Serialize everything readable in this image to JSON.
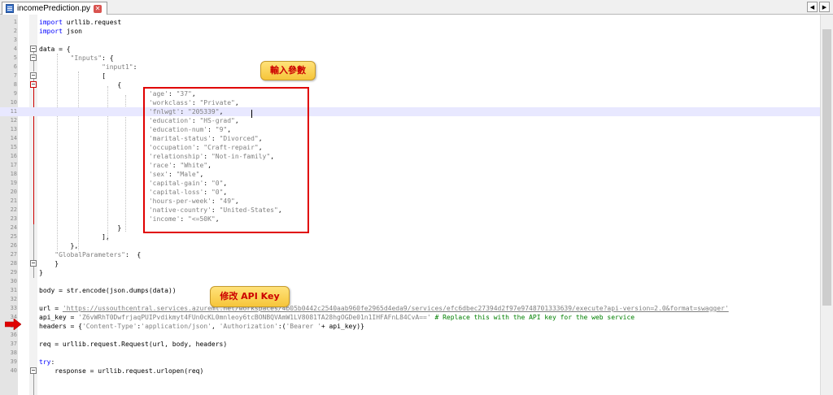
{
  "tab": {
    "filename": "incomePrediction.py",
    "close_glyph": "✕"
  },
  "nav": {
    "prev_glyph": "◀",
    "next_glyph": "▶"
  },
  "callouts": {
    "input_params": "輸入參數",
    "modify_api_key": "修改 API Key"
  },
  "colors": {
    "keyword": "#0000ff",
    "string": "#808080",
    "comment": "#008000",
    "highlight": "#e8e8ff",
    "annotation_box": "#e00000",
    "callout_bg": "#f6c53a",
    "callout_text": "#cc0000",
    "arrow": "#e00000"
  },
  "lines": [
    {
      "n": "1",
      "segs": [
        {
          "t": "import",
          "c": "kw"
        },
        {
          "t": " urllib.request"
        }
      ]
    },
    {
      "n": "2",
      "segs": [
        {
          "t": "import",
          "c": "kw"
        },
        {
          "t": " json"
        }
      ]
    },
    {
      "n": "3",
      "segs": []
    },
    {
      "n": "4",
      "segs": [
        {
          "t": "data = {"
        }
      ]
    },
    {
      "n": "5",
      "segs": [
        {
          "t": "        "
        },
        {
          "t": "\"Inputs\"",
          "c": "str"
        },
        {
          "t": ": {"
        }
      ]
    },
    {
      "n": "6",
      "segs": [
        {
          "t": "                "
        },
        {
          "t": "\"input1\"",
          "c": "str"
        },
        {
          "t": ":"
        }
      ]
    },
    {
      "n": "7",
      "segs": [
        {
          "t": "                ["
        }
      ]
    },
    {
      "n": "8",
      "segs": [
        {
          "t": "                    {"
        }
      ]
    },
    {
      "n": "9",
      "segs": [
        {
          "t": "                            "
        },
        {
          "t": "'age'",
          "c": "str"
        },
        {
          "t": ": "
        },
        {
          "t": "\"37\"",
          "c": "str"
        },
        {
          "t": ","
        }
      ]
    },
    {
      "n": "10",
      "segs": [
        {
          "t": "                            "
        },
        {
          "t": "'workclass'",
          "c": "str"
        },
        {
          "t": ": "
        },
        {
          "t": "\"Private\"",
          "c": "str"
        },
        {
          "t": ","
        }
      ]
    },
    {
      "n": "11",
      "segs": [
        {
          "t": "                            "
        },
        {
          "t": "'fnlwgt'",
          "c": "str"
        },
        {
          "t": ": "
        },
        {
          "t": "\"205339\"",
          "c": "str"
        },
        {
          "t": ","
        }
      ]
    },
    {
      "n": "12",
      "segs": [
        {
          "t": "                            "
        },
        {
          "t": "'education'",
          "c": "str"
        },
        {
          "t": ": "
        },
        {
          "t": "\"HS-grad\"",
          "c": "str"
        },
        {
          "t": ","
        }
      ]
    },
    {
      "n": "13",
      "segs": [
        {
          "t": "                            "
        },
        {
          "t": "'education-num'",
          "c": "str"
        },
        {
          "t": ": "
        },
        {
          "t": "\"9\"",
          "c": "str"
        },
        {
          "t": ","
        }
      ]
    },
    {
      "n": "14",
      "segs": [
        {
          "t": "                            "
        },
        {
          "t": "'marital-status'",
          "c": "str"
        },
        {
          "t": ": "
        },
        {
          "t": "\"Divorced\"",
          "c": "str"
        },
        {
          "t": ","
        }
      ]
    },
    {
      "n": "15",
      "segs": [
        {
          "t": "                            "
        },
        {
          "t": "'occupation'",
          "c": "str"
        },
        {
          "t": ": "
        },
        {
          "t": "\"Craft-repair\"",
          "c": "str"
        },
        {
          "t": ","
        }
      ]
    },
    {
      "n": "16",
      "segs": [
        {
          "t": "                            "
        },
        {
          "t": "'relationship'",
          "c": "str"
        },
        {
          "t": ": "
        },
        {
          "t": "\"Not-in-family\"",
          "c": "str"
        },
        {
          "t": ","
        }
      ]
    },
    {
      "n": "17",
      "segs": [
        {
          "t": "                            "
        },
        {
          "t": "'race'",
          "c": "str"
        },
        {
          "t": ": "
        },
        {
          "t": "\"White\"",
          "c": "str"
        },
        {
          "t": ","
        }
      ]
    },
    {
      "n": "18",
      "segs": [
        {
          "t": "                            "
        },
        {
          "t": "'sex'",
          "c": "str"
        },
        {
          "t": ": "
        },
        {
          "t": "\"Male\"",
          "c": "str"
        },
        {
          "t": ","
        }
      ]
    },
    {
      "n": "19",
      "segs": [
        {
          "t": "                            "
        },
        {
          "t": "'capital-gain'",
          "c": "str"
        },
        {
          "t": ": "
        },
        {
          "t": "\"0\"",
          "c": "str"
        },
        {
          "t": ","
        }
      ]
    },
    {
      "n": "20",
      "segs": [
        {
          "t": "                            "
        },
        {
          "t": "'capital-loss'",
          "c": "str"
        },
        {
          "t": ": "
        },
        {
          "t": "\"0\"",
          "c": "str"
        },
        {
          "t": ","
        }
      ]
    },
    {
      "n": "21",
      "segs": [
        {
          "t": "                            "
        },
        {
          "t": "'hours-per-week'",
          "c": "str"
        },
        {
          "t": ": "
        },
        {
          "t": "\"49\"",
          "c": "str"
        },
        {
          "t": ","
        }
      ]
    },
    {
      "n": "22",
      "segs": [
        {
          "t": "                            "
        },
        {
          "t": "'native-country'",
          "c": "str"
        },
        {
          "t": ": "
        },
        {
          "t": "\"United-States\"",
          "c": "str"
        },
        {
          "t": ","
        }
      ]
    },
    {
      "n": "23",
      "segs": [
        {
          "t": "                            "
        },
        {
          "t": "'income'",
          "c": "str"
        },
        {
          "t": ": "
        },
        {
          "t": "\"<=50K\"",
          "c": "str"
        },
        {
          "t": ","
        }
      ]
    },
    {
      "n": "24",
      "segs": [
        {
          "t": "                    }"
        }
      ]
    },
    {
      "n": "25",
      "segs": [
        {
          "t": "                ],"
        }
      ]
    },
    {
      "n": "26",
      "segs": [
        {
          "t": "        },"
        }
      ]
    },
    {
      "n": "27",
      "segs": [
        {
          "t": "    "
        },
        {
          "t": "\"GlobalParameters\"",
          "c": "str"
        },
        {
          "t": ":  {"
        }
      ]
    },
    {
      "n": "28",
      "segs": [
        {
          "t": "    }"
        }
      ]
    },
    {
      "n": "29",
      "segs": [
        {
          "t": "}"
        }
      ]
    },
    {
      "n": "30",
      "segs": []
    },
    {
      "n": "31",
      "segs": [
        {
          "t": "body = str.encode(json.dumps(data))"
        }
      ]
    },
    {
      "n": "32",
      "segs": []
    },
    {
      "n": "33",
      "segs": [
        {
          "t": "url = "
        },
        {
          "t": "'https://ussouthcentral.services.azureml.net/workspaces/4b05b0442c2540aab960fe2965d4eda9/services/efc6dbec27394d2f97e9748701333639/execute?api-version=2.0&format=swagger'",
          "c": "url"
        }
      ]
    },
    {
      "n": "34",
      "segs": [
        {
          "t": "api_key = "
        },
        {
          "t": "'Z6vWRhT0DwfrjaqPUIPvdikmyt4FUn0cKL0mnleoy6tcBONBQVAmW1LV8081TA28hgOGDe01n1IHFAFnL84CvA=='",
          "c": "str"
        },
        {
          "t": " "
        },
        {
          "t": "# Replace this with the API key for the web service",
          "c": "cmt"
        }
      ]
    },
    {
      "n": "35",
      "segs": [
        {
          "t": "headers = {"
        },
        {
          "t": "'Content-Type'",
          "c": "str"
        },
        {
          "t": ":"
        },
        {
          "t": "'application/json'",
          "c": "str"
        },
        {
          "t": ", "
        },
        {
          "t": "'Authorization'",
          "c": "str"
        },
        {
          "t": ":("
        },
        {
          "t": "'Bearer '",
          "c": "str"
        },
        {
          "t": "+ api_key)}"
        }
      ]
    },
    {
      "n": "36",
      "segs": []
    },
    {
      "n": "37",
      "segs": [
        {
          "t": "req = urllib.request.Request(url, body, headers)"
        }
      ]
    },
    {
      "n": "38",
      "segs": []
    },
    {
      "n": "39",
      "segs": [
        {
          "t": "try",
          "c": "kw"
        },
        {
          "t": ":"
        }
      ]
    },
    {
      "n": "40",
      "segs": [
        {
          "t": "    response = urllib.request.urlopen(req)"
        }
      ]
    }
  ]
}
